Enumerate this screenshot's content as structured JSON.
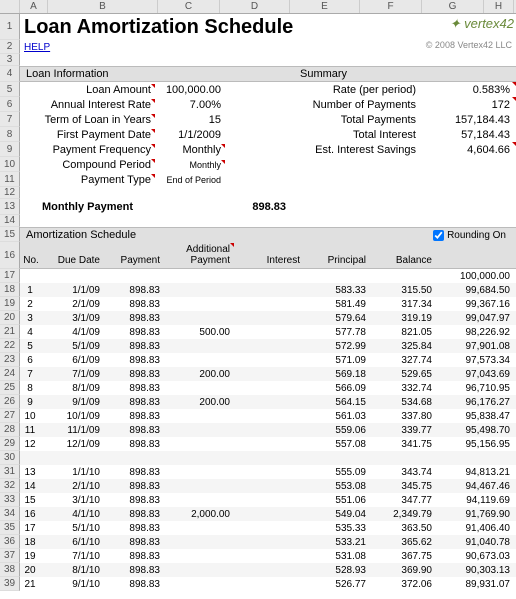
{
  "columns": [
    "A",
    "B",
    "C",
    "D",
    "E",
    "F",
    "G",
    "H"
  ],
  "title": "Loan Amortization Schedule",
  "logo": "✦ vertex42",
  "copyright": "© 2008 Vertex42 LLC",
  "help": "HELP",
  "section": {
    "loan": "Loan Information",
    "summary": "Summary"
  },
  "info": {
    "labels": {
      "amount": "Loan Amount",
      "rate": "Annual Interest Rate",
      "term": "Term of Loan in Years",
      "first": "First Payment Date",
      "freq": "Payment Frequency",
      "compound": "Compound Period",
      "ptype": "Payment Type"
    },
    "values": {
      "amount": "100,000.00",
      "rate": "7.00%",
      "term": "15",
      "first": "1/1/2009",
      "freq": "Monthly",
      "compound": "Monthly",
      "ptype": "End of Period"
    }
  },
  "summary": {
    "labels": {
      "rate": "Rate (per period)",
      "num": "Number of Payments",
      "total": "Total Payments",
      "interest": "Total Interest",
      "savings": "Est. Interest Savings"
    },
    "values": {
      "rate": "0.583%",
      "num": "172",
      "total": "157,184.43",
      "interest": "57,184.43",
      "savings": "4,604.66"
    }
  },
  "monthly": {
    "label": "Monthly Payment",
    "value": "898.83"
  },
  "amort": {
    "title": "Amortization Schedule",
    "rounding": "Rounding On"
  },
  "cols": {
    "no": "No.",
    "due": "Due Date",
    "pay": "Payment",
    "addl1": "Additional",
    "addl2": "Payment",
    "int": "Interest",
    "prin": "Principal",
    "bal": "Balance"
  },
  "rows": [
    {
      "no": "",
      "due": "",
      "pay": "",
      "addl": "",
      "int": "",
      "prin": "",
      "bal": "100,000.00"
    },
    {
      "no": "1",
      "due": "1/1/09",
      "pay": "898.83",
      "addl": "",
      "int": "583.33",
      "prin": "315.50",
      "bal": "99,684.50"
    },
    {
      "no": "2",
      "due": "2/1/09",
      "pay": "898.83",
      "addl": "",
      "int": "581.49",
      "prin": "317.34",
      "bal": "99,367.16"
    },
    {
      "no": "3",
      "due": "3/1/09",
      "pay": "898.83",
      "addl": "",
      "int": "579.64",
      "prin": "319.19",
      "bal": "99,047.97"
    },
    {
      "no": "4",
      "due": "4/1/09",
      "pay": "898.83",
      "addl": "500.00",
      "int": "577.78",
      "prin": "821.05",
      "bal": "98,226.92"
    },
    {
      "no": "5",
      "due": "5/1/09",
      "pay": "898.83",
      "addl": "",
      "int": "572.99",
      "prin": "325.84",
      "bal": "97,901.08"
    },
    {
      "no": "6",
      "due": "6/1/09",
      "pay": "898.83",
      "addl": "",
      "int": "571.09",
      "prin": "327.74",
      "bal": "97,573.34"
    },
    {
      "no": "7",
      "due": "7/1/09",
      "pay": "898.83",
      "addl": "200.00",
      "int": "569.18",
      "prin": "529.65",
      "bal": "97,043.69"
    },
    {
      "no": "8",
      "due": "8/1/09",
      "pay": "898.83",
      "addl": "",
      "int": "566.09",
      "prin": "332.74",
      "bal": "96,710.95"
    },
    {
      "no": "9",
      "due": "9/1/09",
      "pay": "898.83",
      "addl": "200.00",
      "int": "564.15",
      "prin": "534.68",
      "bal": "96,176.27"
    },
    {
      "no": "10",
      "due": "10/1/09",
      "pay": "898.83",
      "addl": "",
      "int": "561.03",
      "prin": "337.80",
      "bal": "95,838.47"
    },
    {
      "no": "11",
      "due": "11/1/09",
      "pay": "898.83",
      "addl": "",
      "int": "559.06",
      "prin": "339.77",
      "bal": "95,498.70"
    },
    {
      "no": "12",
      "due": "12/1/09",
      "pay": "898.83",
      "addl": "",
      "int": "557.08",
      "prin": "341.75",
      "bal": "95,156.95"
    },
    {
      "no": "",
      "due": "",
      "pay": "",
      "addl": "",
      "int": "",
      "prin": "",
      "bal": ""
    },
    {
      "no": "13",
      "due": "1/1/10",
      "pay": "898.83",
      "addl": "",
      "int": "555.09",
      "prin": "343.74",
      "bal": "94,813.21"
    },
    {
      "no": "14",
      "due": "2/1/10",
      "pay": "898.83",
      "addl": "",
      "int": "553.08",
      "prin": "345.75",
      "bal": "94,467.46"
    },
    {
      "no": "15",
      "due": "3/1/10",
      "pay": "898.83",
      "addl": "",
      "int": "551.06",
      "prin": "347.77",
      "bal": "94,119.69"
    },
    {
      "no": "16",
      "due": "4/1/10",
      "pay": "898.83",
      "addl": "2,000.00",
      "int": "549.04",
      "prin": "2,349.79",
      "bal": "91,769.90"
    },
    {
      "no": "17",
      "due": "5/1/10",
      "pay": "898.83",
      "addl": "",
      "int": "535.33",
      "prin": "363.50",
      "bal": "91,406.40"
    },
    {
      "no": "18",
      "due": "6/1/10",
      "pay": "898.83",
      "addl": "",
      "int": "533.21",
      "prin": "365.62",
      "bal": "91,040.78"
    },
    {
      "no": "19",
      "due": "7/1/10",
      "pay": "898.83",
      "addl": "",
      "int": "531.08",
      "prin": "367.75",
      "bal": "90,673.03"
    },
    {
      "no": "20",
      "due": "8/1/10",
      "pay": "898.83",
      "addl": "",
      "int": "528.93",
      "prin": "369.90",
      "bal": "90,303.13"
    },
    {
      "no": "21",
      "due": "9/1/10",
      "pay": "898.83",
      "addl": "",
      "int": "526.77",
      "prin": "372.06",
      "bal": "89,931.07"
    }
  ]
}
